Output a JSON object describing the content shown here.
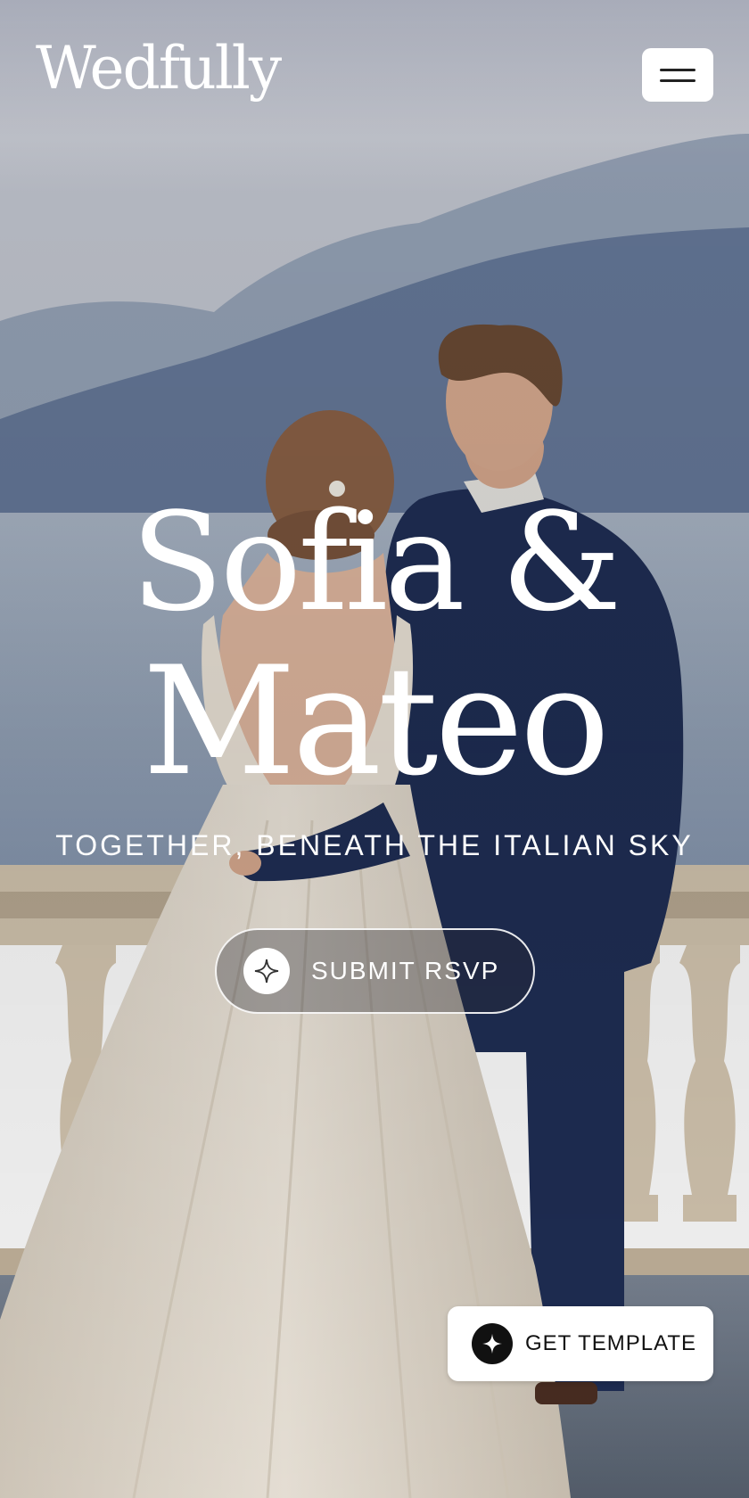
{
  "brand": {
    "logo_text": "Wedfully"
  },
  "header": {
    "menu_icon": "hamburger-menu-icon"
  },
  "hero": {
    "title_line1": "Sofia &",
    "title_line2": "Mateo",
    "tagline": "TOGETHER, BENEATH THE ITALIAN SKY",
    "rsvp_button": {
      "label": "SUBMIT RSVP",
      "icon": "sparkle-icon"
    }
  },
  "cta": {
    "label": "GET TEMPLATE",
    "icon": "sparkle-icon"
  },
  "colors": {
    "text_light": "#ffffff",
    "text_dark": "#111111",
    "sky": "#c9cdd6",
    "mountain": "#6a7c98",
    "lake": "#9fb0c5",
    "suit": "#1f2e55",
    "dress": "#e9e1d4",
    "stone": "#d2c3ad"
  }
}
